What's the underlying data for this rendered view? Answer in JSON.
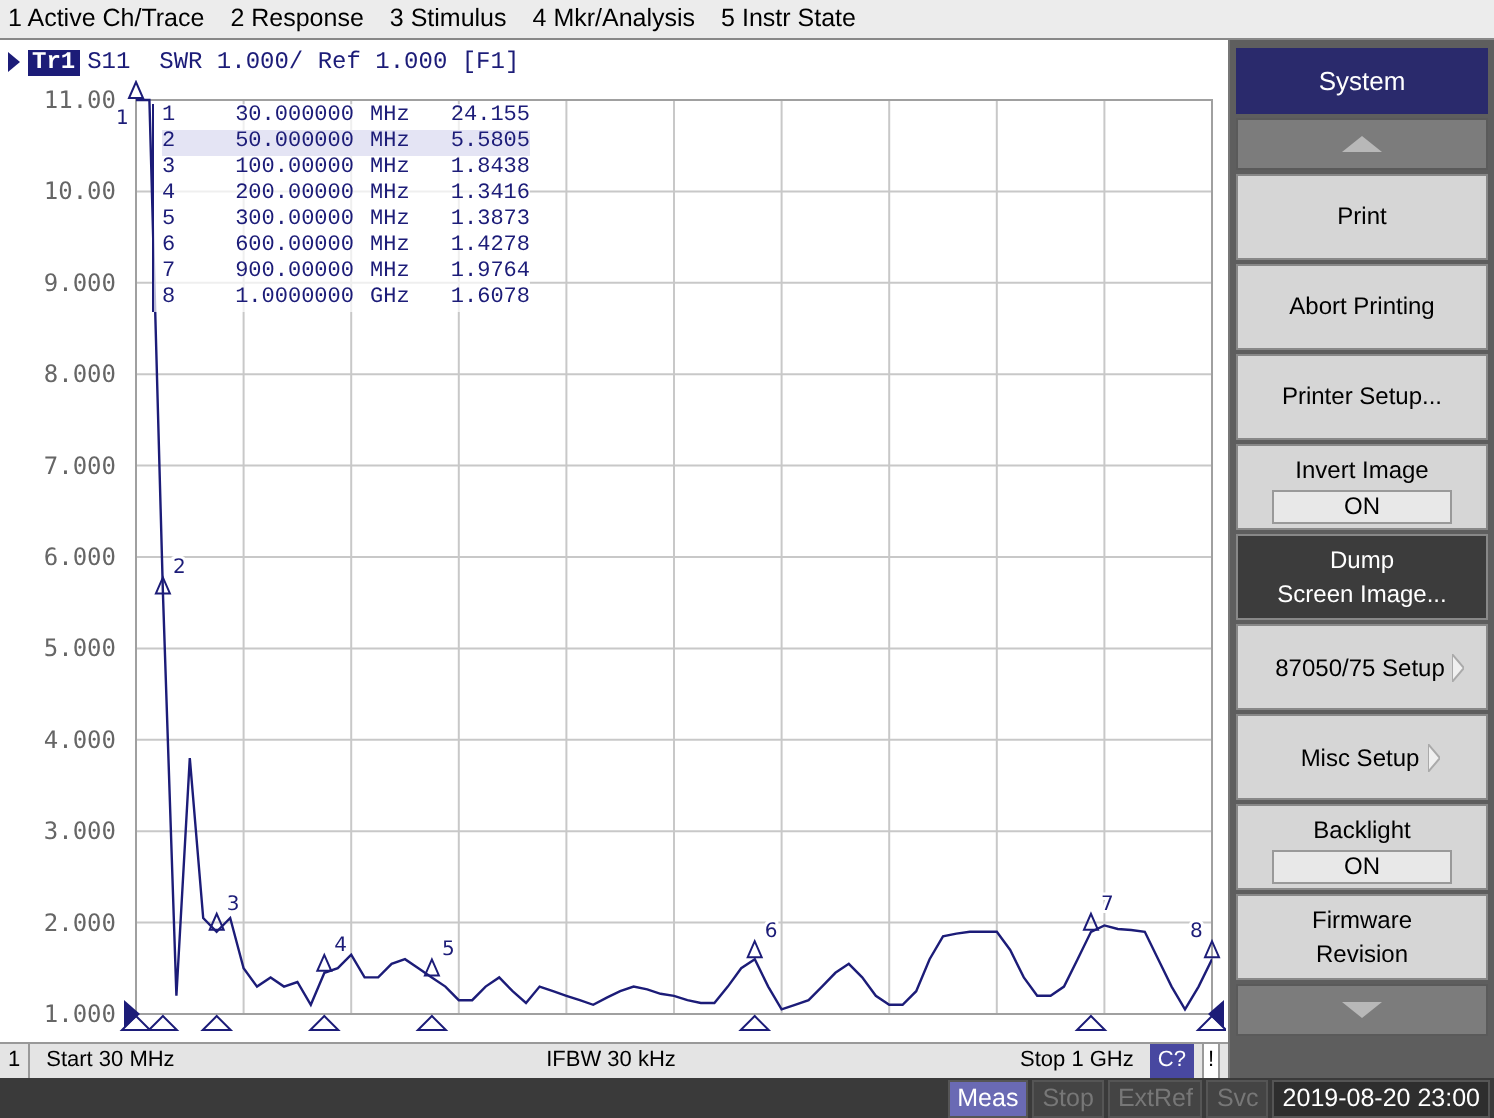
{
  "menu_bar": [
    "1 Active Ch/Trace",
    "2 Response",
    "3 Stimulus",
    "4 Mkr/Analysis",
    "5 Instr State"
  ],
  "trace_header": {
    "trace": "Tr1",
    "text": "S11  SWR 1.000/ Ref 1.000 [F1]"
  },
  "marker_table": [
    {
      "number": "1",
      "frequency": "30.000000",
      "unit": "MHz",
      "value": "24.155",
      "selected": false
    },
    {
      "number": "2",
      "frequency": "50.000000",
      "unit": "MHz",
      "value": "5.5805",
      "selected": true
    },
    {
      "number": "3",
      "frequency": "100.00000",
      "unit": "MHz",
      "value": "1.8438",
      "selected": false
    },
    {
      "number": "4",
      "frequency": "200.00000",
      "unit": "MHz",
      "value": "1.3416",
      "selected": false
    },
    {
      "number": "5",
      "frequency": "300.00000",
      "unit": "MHz",
      "value": "1.3873",
      "selected": false
    },
    {
      "number": "6",
      "frequency": "600.00000",
      "unit": "MHz",
      "value": "1.4278",
      "selected": false
    },
    {
      "number": "7",
      "frequency": "900.00000",
      "unit": "MHz",
      "value": "1.9764",
      "selected": false
    },
    {
      "number": "8",
      "frequency": "1.0000000",
      "unit": "GHz",
      "value": "1.6078",
      "selected": false
    }
  ],
  "trace_markers": [
    {
      "label": "1"
    },
    {
      "label": "2"
    },
    {
      "label": "3"
    },
    {
      "label": "4"
    },
    {
      "label": "5"
    },
    {
      "label": "6"
    },
    {
      "label": "7"
    },
    {
      "label": "8"
    }
  ],
  "chart_data": {
    "type": "line",
    "grid": true,
    "ylim": [
      1,
      11
    ],
    "yticks": [
      {
        "value": 11,
        "label": "11.00"
      },
      {
        "value": 10,
        "label": "10.00"
      },
      {
        "value": 9,
        "label": "9.000"
      },
      {
        "value": 8,
        "label": "8.000"
      },
      {
        "value": 7,
        "label": "7.000"
      },
      {
        "value": 6,
        "label": "6.000"
      },
      {
        "value": 5,
        "label": "5.000"
      },
      {
        "value": 4,
        "label": "4.000"
      },
      {
        "value": 3,
        "label": "3.000"
      },
      {
        "value": 2,
        "label": "2.000"
      },
      {
        "value": 1,
        "label": "1.000"
      }
    ],
    "categories": [
      null,
      null,
      null,
      null,
      null,
      null,
      null,
      null,
      null,
      null,
      null,
      null,
      null,
      null,
      null,
      null,
      null,
      null,
      null,
      null,
      null,
      null,
      null,
      null,
      null,
      null,
      null,
      null,
      null,
      null,
      null,
      null,
      null,
      null,
      null,
      null,
      null,
      null,
      null,
      null,
      null,
      null,
      null,
      null,
      null,
      null,
      null,
      null,
      null,
      null,
      null,
      null,
      null,
      null,
      null,
      null,
      null,
      null,
      null,
      null,
      null,
      null,
      null,
      null,
      null,
      null,
      null,
      null,
      null,
      null,
      null,
      null,
      null,
      null,
      null,
      null,
      null,
      null,
      null,
      null,
      null
    ],
    "series": [
      {
        "color": "#1c1c78",
        "values": [
          11,
          11,
          5.58,
          1.2,
          3.8,
          2.05,
          1.9,
          2.05,
          1.5,
          1.3,
          1.4,
          1.3,
          1.35,
          1.1,
          1.45,
          1.5,
          1.65,
          1.4,
          1.4,
          1.55,
          1.6,
          1.5,
          1.4,
          1.3,
          1.15,
          1.15,
          1.3,
          1.4,
          1.25,
          1.12,
          1.3,
          1.25,
          1.2,
          1.15,
          1.1,
          1.18,
          1.25,
          1.3,
          1.27,
          1.22,
          1.2,
          1.15,
          1.12,
          1.12,
          1.3,
          1.5,
          1.6,
          1.3,
          1.05,
          1.1,
          1.15,
          1.3,
          1.45,
          1.55,
          1.4,
          1.2,
          1.1,
          1.1,
          1.25,
          1.6,
          1.85,
          1.88,
          1.9,
          1.9,
          1.9,
          1.7,
          1.4,
          1.2,
          1.2,
          1.3,
          1.6,
          1.9,
          1.97,
          1.93,
          1.92,
          1.9,
          1.6,
          1.3,
          1.05,
          1.3,
          1.6
        ]
      }
    ]
  },
  "footer": {
    "channel": "1",
    "start": "Start 30 MHz",
    "ifbw": "IFBW 30 kHz",
    "stop": "Stop 1 GHz",
    "cal": "C?",
    "alert": "!"
  },
  "softkeys": {
    "title": "System",
    "items": [
      {
        "kind": "up_arrow"
      },
      {
        "kind": "button",
        "label": "Print",
        "selected": false
      },
      {
        "kind": "button",
        "label": "Abort Printing",
        "selected": false
      },
      {
        "kind": "button",
        "label": "Printer Setup...",
        "selected": false
      },
      {
        "kind": "toggle",
        "label": "Invert Image",
        "value": "ON"
      },
      {
        "kind": "button",
        "label": "Dump\nScreen Image...",
        "selected": true
      },
      {
        "kind": "submenu",
        "label": "87050/75 Setup"
      },
      {
        "kind": "submenu",
        "label": "Misc Setup"
      },
      {
        "kind": "toggle",
        "label": "Backlight",
        "value": "ON"
      },
      {
        "kind": "button",
        "label": "Firmware\nRevision",
        "selected": false
      },
      {
        "kind": "down_arrow"
      }
    ]
  },
  "status_bar": [
    {
      "label": "Meas",
      "active": true
    },
    {
      "label": "Stop",
      "active": false
    },
    {
      "label": "ExtRef",
      "active": false
    },
    {
      "label": "Svc",
      "active": false
    },
    {
      "label": "2019-08-20 23:00",
      "active": true
    }
  ]
}
